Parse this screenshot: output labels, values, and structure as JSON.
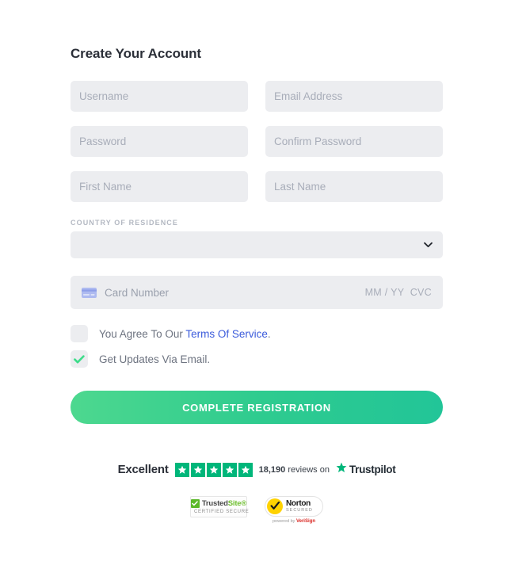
{
  "form": {
    "heading": "Create Your Account",
    "fields": [
      {
        "name": "username",
        "placeholder": "Username",
        "value": ""
      },
      {
        "name": "email",
        "placeholder": "Email Address",
        "value": ""
      },
      {
        "name": "password",
        "placeholder": "Password",
        "value": ""
      },
      {
        "name": "confirm_password",
        "placeholder": "Confirm Password",
        "value": ""
      },
      {
        "name": "first_name",
        "placeholder": "First Name",
        "value": ""
      },
      {
        "name": "last_name",
        "placeholder": "Last Name",
        "value": ""
      }
    ],
    "country": {
      "label": "Country Of Residence",
      "selected": "",
      "icon": "chevron-down-icon"
    },
    "card": {
      "icon": "credit-card-icon",
      "placeholder": "Card Number",
      "expiry_cvc": "MM / YY  CVC"
    },
    "agreements": [
      {
        "name": "terms",
        "checked": false,
        "text_before": "You Agree To Our ",
        "link_text": "Terms Of Service",
        "text_after": "."
      },
      {
        "name": "updates",
        "checked": true,
        "text_before": "Get Updates Via Email.",
        "link_text": "",
        "text_after": ""
      }
    ],
    "submit_label": "COMPLETE REGISTRATION"
  },
  "trustpilot": {
    "rating_word": "Excellent",
    "stars": 5,
    "review_count": "18,190",
    "reviews_on": " reviews on ",
    "brand": "Trustpilot",
    "star_color": "#00b67a"
  },
  "badges": {
    "trustedsite": {
      "name_part1": "Trusted",
      "name_part2": "Site",
      "superscript": "®",
      "subtitle": "CERTIFIED SECURE",
      "icon": "green-check-icon",
      "accent": "#6fbf2f"
    },
    "norton": {
      "name": "Norton",
      "secured": "SECURED",
      "powered_by": "powered by ",
      "verisign": "VeriSign",
      "icon": "norton-check-icon",
      "accent": "#ffd200"
    }
  }
}
